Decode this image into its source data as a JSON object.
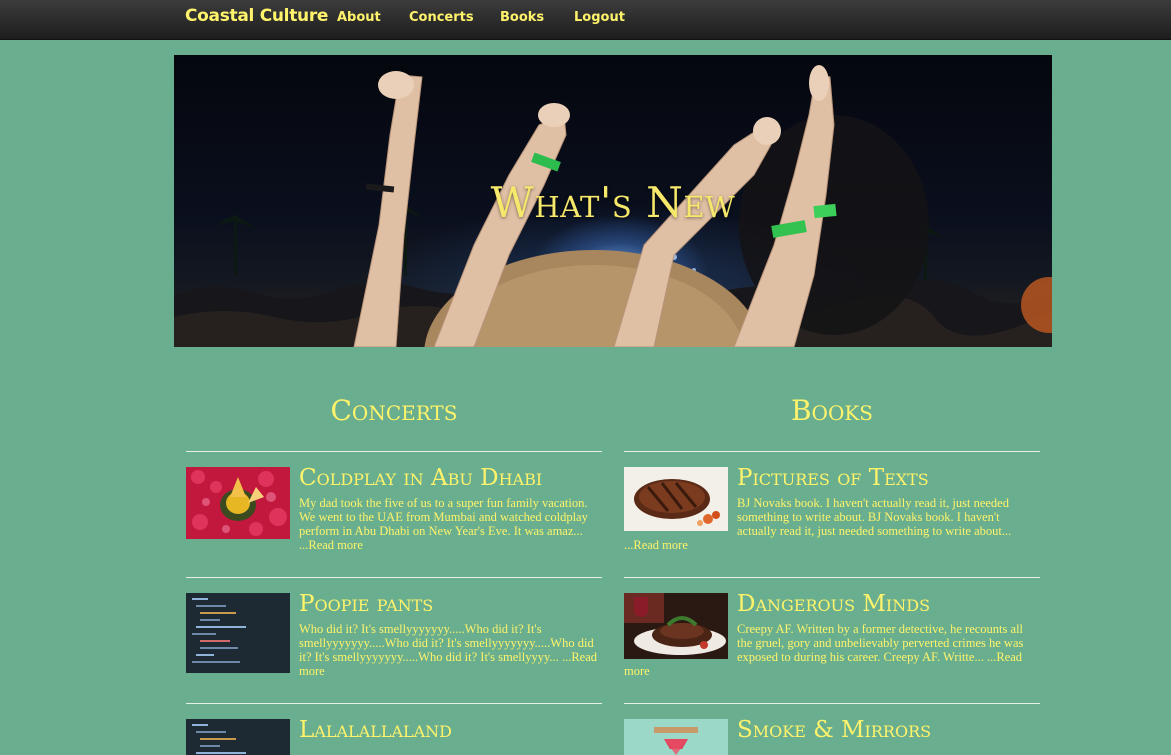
{
  "nav": {
    "brand": "Coastal Culture",
    "links": [
      "About",
      "Concerts",
      "Books",
      "Logout"
    ]
  },
  "hero": {
    "title": "What's New"
  },
  "sections": {
    "concerts": {
      "title": "Concerts",
      "posts": [
        {
          "title": "Coldplay in Abu Dhabi",
          "excerpt": "My dad took the five of us to a super fun family vacation. We went to the UAE from Mumbai and watched coldplay perform in Abu Dhabi on New Year's Eve. It was amaz...",
          "read_more": "...Read more",
          "thumb_icon": "flower-bowl-photo"
        },
        {
          "title": "Poopie pants",
          "excerpt": "Who did it? It's smellyyyyyyy.....Who did it? It's smellyyyyyyy.....Who did it? It's smellyyyyyyy.....Who did it? It's smellyyyyyyy.....Who did it? It's smellyyyy...",
          "read_more": "...Read more",
          "thumb_icon": "code-screenshot"
        },
        {
          "title": "Lalalallaland",
          "excerpt": "",
          "read_more": "",
          "thumb_icon": "code-screenshot"
        }
      ]
    },
    "books": {
      "title": "Books",
      "posts": [
        {
          "title": "Pictures of Texts",
          "excerpt": "BJ Novaks book. I haven't actually read it, just needed something to write about. BJ Novaks book. I haven't actually read it, just needed something to write about...",
          "read_more": "...Read more",
          "thumb_icon": "steak-photo"
        },
        {
          "title": "Dangerous Minds",
          "excerpt": "Creepy AF. Written by a former detective, he recounts all the gruel, gory and unbelievably perverted crimes he was exposed to during his career. Creepy AF. Writte...",
          "read_more": "...Read more",
          "thumb_icon": "steak-wine-photo"
        },
        {
          "title": "Smoke & Mirrors",
          "excerpt": "",
          "read_more": "",
          "thumb_icon": "gem-illustration"
        }
      ]
    }
  },
  "colors": {
    "background": "#69af8f",
    "accent": "#fff36b",
    "navbar": "#2a2a2a"
  }
}
